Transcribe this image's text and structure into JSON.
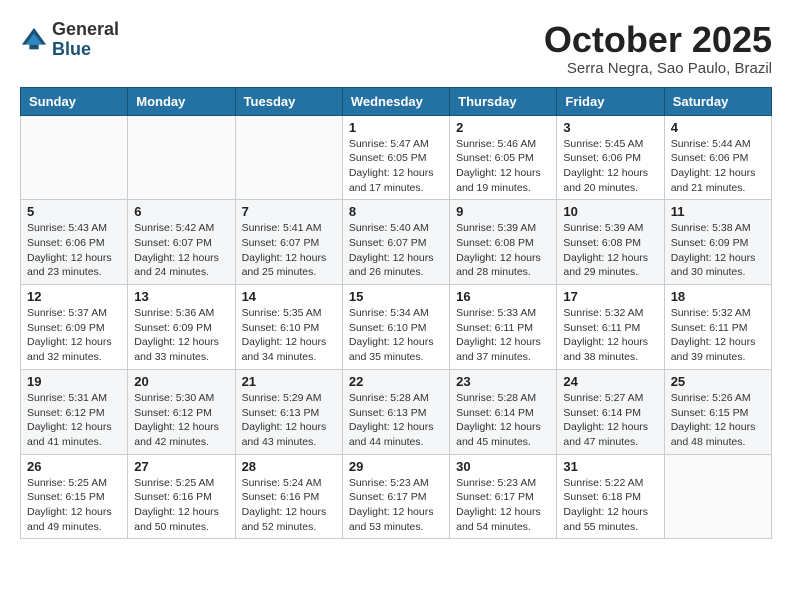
{
  "logo": {
    "general": "General",
    "blue": "Blue"
  },
  "header": {
    "month": "October 2025",
    "location": "Serra Negra, Sao Paulo, Brazil"
  },
  "weekdays": [
    "Sunday",
    "Monday",
    "Tuesday",
    "Wednesday",
    "Thursday",
    "Friday",
    "Saturday"
  ],
  "weeks": [
    [
      {
        "day": "",
        "info": ""
      },
      {
        "day": "",
        "info": ""
      },
      {
        "day": "",
        "info": ""
      },
      {
        "day": "1",
        "info": "Sunrise: 5:47 AM\nSunset: 6:05 PM\nDaylight: 12 hours\nand 17 minutes."
      },
      {
        "day": "2",
        "info": "Sunrise: 5:46 AM\nSunset: 6:05 PM\nDaylight: 12 hours\nand 19 minutes."
      },
      {
        "day": "3",
        "info": "Sunrise: 5:45 AM\nSunset: 6:06 PM\nDaylight: 12 hours\nand 20 minutes."
      },
      {
        "day": "4",
        "info": "Sunrise: 5:44 AM\nSunset: 6:06 PM\nDaylight: 12 hours\nand 21 minutes."
      }
    ],
    [
      {
        "day": "5",
        "info": "Sunrise: 5:43 AM\nSunset: 6:06 PM\nDaylight: 12 hours\nand 23 minutes."
      },
      {
        "day": "6",
        "info": "Sunrise: 5:42 AM\nSunset: 6:07 PM\nDaylight: 12 hours\nand 24 minutes."
      },
      {
        "day": "7",
        "info": "Sunrise: 5:41 AM\nSunset: 6:07 PM\nDaylight: 12 hours\nand 25 minutes."
      },
      {
        "day": "8",
        "info": "Sunrise: 5:40 AM\nSunset: 6:07 PM\nDaylight: 12 hours\nand 26 minutes."
      },
      {
        "day": "9",
        "info": "Sunrise: 5:39 AM\nSunset: 6:08 PM\nDaylight: 12 hours\nand 28 minutes."
      },
      {
        "day": "10",
        "info": "Sunrise: 5:39 AM\nSunset: 6:08 PM\nDaylight: 12 hours\nand 29 minutes."
      },
      {
        "day": "11",
        "info": "Sunrise: 5:38 AM\nSunset: 6:09 PM\nDaylight: 12 hours\nand 30 minutes."
      }
    ],
    [
      {
        "day": "12",
        "info": "Sunrise: 5:37 AM\nSunset: 6:09 PM\nDaylight: 12 hours\nand 32 minutes."
      },
      {
        "day": "13",
        "info": "Sunrise: 5:36 AM\nSunset: 6:09 PM\nDaylight: 12 hours\nand 33 minutes."
      },
      {
        "day": "14",
        "info": "Sunrise: 5:35 AM\nSunset: 6:10 PM\nDaylight: 12 hours\nand 34 minutes."
      },
      {
        "day": "15",
        "info": "Sunrise: 5:34 AM\nSunset: 6:10 PM\nDaylight: 12 hours\nand 35 minutes."
      },
      {
        "day": "16",
        "info": "Sunrise: 5:33 AM\nSunset: 6:11 PM\nDaylight: 12 hours\nand 37 minutes."
      },
      {
        "day": "17",
        "info": "Sunrise: 5:32 AM\nSunset: 6:11 PM\nDaylight: 12 hours\nand 38 minutes."
      },
      {
        "day": "18",
        "info": "Sunrise: 5:32 AM\nSunset: 6:11 PM\nDaylight: 12 hours\nand 39 minutes."
      }
    ],
    [
      {
        "day": "19",
        "info": "Sunrise: 5:31 AM\nSunset: 6:12 PM\nDaylight: 12 hours\nand 41 minutes."
      },
      {
        "day": "20",
        "info": "Sunrise: 5:30 AM\nSunset: 6:12 PM\nDaylight: 12 hours\nand 42 minutes."
      },
      {
        "day": "21",
        "info": "Sunrise: 5:29 AM\nSunset: 6:13 PM\nDaylight: 12 hours\nand 43 minutes."
      },
      {
        "day": "22",
        "info": "Sunrise: 5:28 AM\nSunset: 6:13 PM\nDaylight: 12 hours\nand 44 minutes."
      },
      {
        "day": "23",
        "info": "Sunrise: 5:28 AM\nSunset: 6:14 PM\nDaylight: 12 hours\nand 45 minutes."
      },
      {
        "day": "24",
        "info": "Sunrise: 5:27 AM\nSunset: 6:14 PM\nDaylight: 12 hours\nand 47 minutes."
      },
      {
        "day": "25",
        "info": "Sunrise: 5:26 AM\nSunset: 6:15 PM\nDaylight: 12 hours\nand 48 minutes."
      }
    ],
    [
      {
        "day": "26",
        "info": "Sunrise: 5:25 AM\nSunset: 6:15 PM\nDaylight: 12 hours\nand 49 minutes."
      },
      {
        "day": "27",
        "info": "Sunrise: 5:25 AM\nSunset: 6:16 PM\nDaylight: 12 hours\nand 50 minutes."
      },
      {
        "day": "28",
        "info": "Sunrise: 5:24 AM\nSunset: 6:16 PM\nDaylight: 12 hours\nand 52 minutes."
      },
      {
        "day": "29",
        "info": "Sunrise: 5:23 AM\nSunset: 6:17 PM\nDaylight: 12 hours\nand 53 minutes."
      },
      {
        "day": "30",
        "info": "Sunrise: 5:23 AM\nSunset: 6:17 PM\nDaylight: 12 hours\nand 54 minutes."
      },
      {
        "day": "31",
        "info": "Sunrise: 5:22 AM\nSunset: 6:18 PM\nDaylight: 12 hours\nand 55 minutes."
      },
      {
        "day": "",
        "info": ""
      }
    ]
  ],
  "colors": {
    "header_bg": "#2471a3",
    "header_text": "#ffffff",
    "border": "#cccccc"
  }
}
